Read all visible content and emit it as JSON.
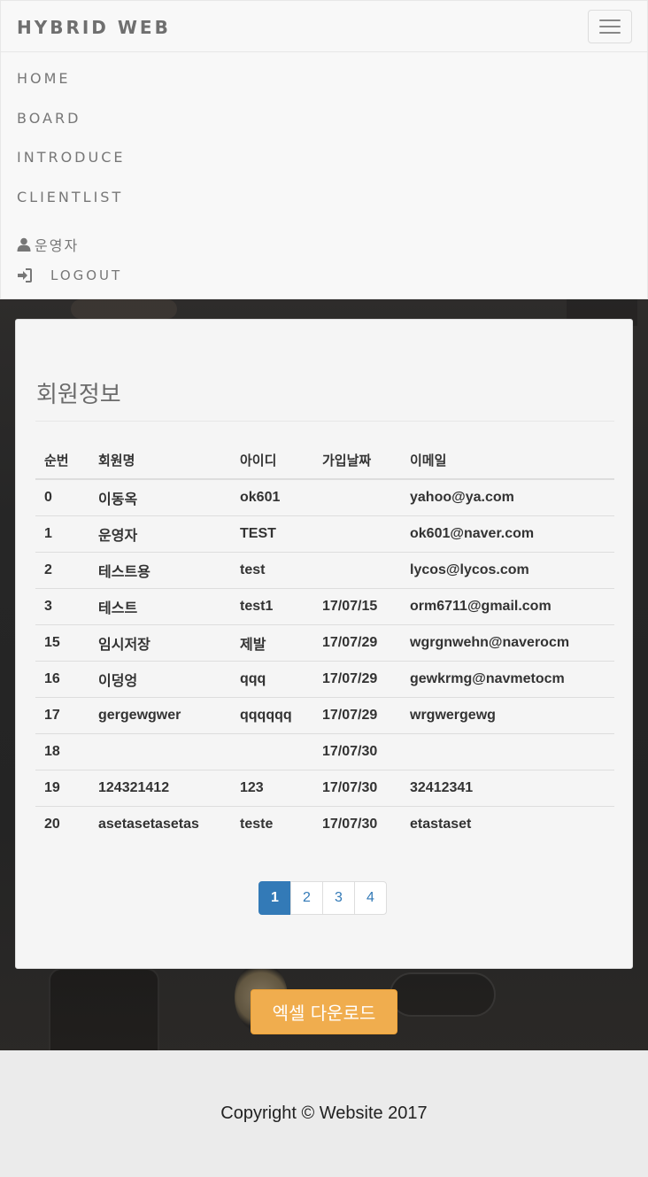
{
  "navbar": {
    "brand": "HYBRID WEB",
    "items": [
      {
        "label": "HOME"
      },
      {
        "label": "BOARD"
      },
      {
        "label": "INTRODUCE"
      },
      {
        "label": "CLIENTLIST"
      }
    ],
    "user_name": "운영자",
    "logout_label": "LOGOUT"
  },
  "panel": {
    "title": "회원정보",
    "columns": [
      "순번",
      "회원명",
      "아이디",
      "가입날짜",
      "이메일"
    ],
    "rows": [
      [
        "0",
        "이동옥",
        "ok601",
        "",
        "yahoo@ya.com"
      ],
      [
        "1",
        "운영자",
        "TEST",
        "",
        "ok601@naver.com"
      ],
      [
        "2",
        "테스트용",
        "test",
        "",
        "lycos@lycos.com"
      ],
      [
        "3",
        "테스트",
        "test1",
        "17/07/15",
        "orm6711@gmail.com"
      ],
      [
        "15",
        "임시저장",
        "제발",
        "17/07/29",
        "wgrgnwehn@naverocm"
      ],
      [
        "16",
        "이덩엉",
        "qqq",
        "17/07/29",
        "gewkrmg@navmetocm"
      ],
      [
        "17",
        "gergewgwer",
        "qqqqqq",
        "17/07/29",
        "wrgwergewg"
      ],
      [
        "18",
        "",
        "",
        "17/07/30",
        ""
      ],
      [
        "19",
        "124321412",
        "123",
        "17/07/30",
        "32412341"
      ],
      [
        "20",
        "asetasetasetas",
        "teste",
        "17/07/30",
        "etastaset"
      ]
    ],
    "pages": [
      "1",
      "2",
      "3",
      "4"
    ],
    "active_page": "1"
  },
  "excel_button_label": "엑셀 다운로드",
  "footer": {
    "copyright": "Copyright © Website 2017"
  },
  "colors": {
    "accent": "#337ab7",
    "excel_button": "#f0ad4e",
    "navbar_bg": "#f8f8f8"
  }
}
